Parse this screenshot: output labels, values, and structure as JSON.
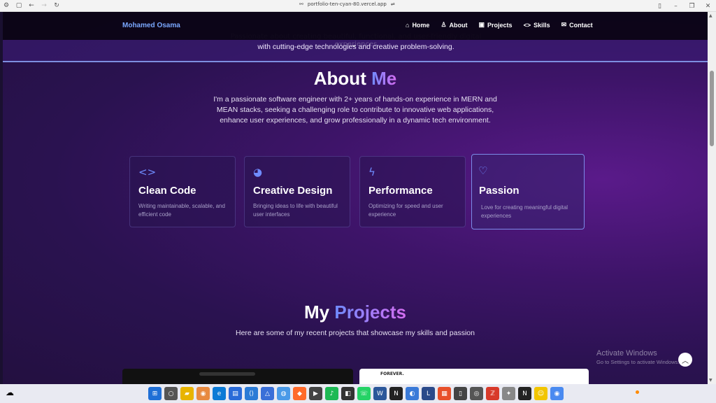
{
  "browser": {
    "url": "portfolio-ten-cyan-80.vercel.app"
  },
  "nav": {
    "brand": "Mohamed Osama",
    "links": [
      {
        "label": "Home"
      },
      {
        "label": "About"
      },
      {
        "label": "Projects"
      },
      {
        "label": "Skills"
      },
      {
        "label": "Contact"
      }
    ]
  },
  "hero": {
    "tagline_faded": "Passionate about creating beautiful, functional, and user-friendly digital experiences",
    "tagline": "with cutting-edge technologies and creative problem-solving."
  },
  "about": {
    "title_plain": "About",
    "title_accent": "Me",
    "text": "I'm a passionate software engineer with 2+ years of hands-on experience in MERN and MEAN stacks, seeking a challenging role to contribute to innovative web applications, enhance user experiences, and grow professionally in a dynamic tech environment.",
    "cards": [
      {
        "icon": "code-icon",
        "title": "Clean Code",
        "desc": "Writing maintainable, scalable, and efficient code"
      },
      {
        "icon": "palette-icon",
        "title": "Creative Design",
        "desc": "Bringing ideas to life with beautiful user interfaces"
      },
      {
        "icon": "lightning-icon",
        "title": "Performance",
        "desc": "Optimizing for speed and user experience"
      },
      {
        "icon": "heart-icon",
        "title": "Passion",
        "desc": "Love for creating meaningful digital experiences"
      }
    ]
  },
  "projects": {
    "title_plain": "My",
    "title_accent": "Projects",
    "subtitle": "Here are some of my recent projects that showcase my skills and passion",
    "thumb2_logo": "FOREVER."
  },
  "watermark": {
    "line1": "Activate Windows",
    "line2": "Go to Settings to activate Windows."
  },
  "colors": {
    "accent_blue": "#6f8cff",
    "accent_pink": "#d46cf0",
    "brand": "#7aa8ff"
  }
}
